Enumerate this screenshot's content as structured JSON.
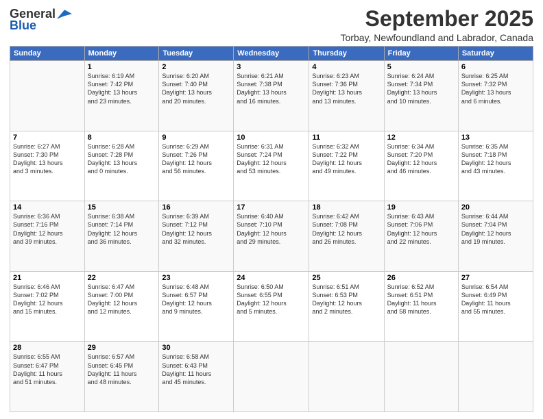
{
  "header": {
    "logo_general": "General",
    "logo_blue": "Blue",
    "month_title": "September 2025",
    "location": "Torbay, Newfoundland and Labrador, Canada"
  },
  "weekdays": [
    "Sunday",
    "Monday",
    "Tuesday",
    "Wednesday",
    "Thursday",
    "Friday",
    "Saturday"
  ],
  "weeks": [
    [
      {
        "day": "",
        "info": ""
      },
      {
        "day": "1",
        "info": "Sunrise: 6:19 AM\nSunset: 7:42 PM\nDaylight: 13 hours\nand 23 minutes."
      },
      {
        "day": "2",
        "info": "Sunrise: 6:20 AM\nSunset: 7:40 PM\nDaylight: 13 hours\nand 20 minutes."
      },
      {
        "day": "3",
        "info": "Sunrise: 6:21 AM\nSunset: 7:38 PM\nDaylight: 13 hours\nand 16 minutes."
      },
      {
        "day": "4",
        "info": "Sunrise: 6:23 AM\nSunset: 7:36 PM\nDaylight: 13 hours\nand 13 minutes."
      },
      {
        "day": "5",
        "info": "Sunrise: 6:24 AM\nSunset: 7:34 PM\nDaylight: 13 hours\nand 10 minutes."
      },
      {
        "day": "6",
        "info": "Sunrise: 6:25 AM\nSunset: 7:32 PM\nDaylight: 13 hours\nand 6 minutes."
      }
    ],
    [
      {
        "day": "7",
        "info": "Sunrise: 6:27 AM\nSunset: 7:30 PM\nDaylight: 13 hours\nand 3 minutes."
      },
      {
        "day": "8",
        "info": "Sunrise: 6:28 AM\nSunset: 7:28 PM\nDaylight: 13 hours\nand 0 minutes."
      },
      {
        "day": "9",
        "info": "Sunrise: 6:29 AM\nSunset: 7:26 PM\nDaylight: 12 hours\nand 56 minutes."
      },
      {
        "day": "10",
        "info": "Sunrise: 6:31 AM\nSunset: 7:24 PM\nDaylight: 12 hours\nand 53 minutes."
      },
      {
        "day": "11",
        "info": "Sunrise: 6:32 AM\nSunset: 7:22 PM\nDaylight: 12 hours\nand 49 minutes."
      },
      {
        "day": "12",
        "info": "Sunrise: 6:34 AM\nSunset: 7:20 PM\nDaylight: 12 hours\nand 46 minutes."
      },
      {
        "day": "13",
        "info": "Sunrise: 6:35 AM\nSunset: 7:18 PM\nDaylight: 12 hours\nand 43 minutes."
      }
    ],
    [
      {
        "day": "14",
        "info": "Sunrise: 6:36 AM\nSunset: 7:16 PM\nDaylight: 12 hours\nand 39 minutes."
      },
      {
        "day": "15",
        "info": "Sunrise: 6:38 AM\nSunset: 7:14 PM\nDaylight: 12 hours\nand 36 minutes."
      },
      {
        "day": "16",
        "info": "Sunrise: 6:39 AM\nSunset: 7:12 PM\nDaylight: 12 hours\nand 32 minutes."
      },
      {
        "day": "17",
        "info": "Sunrise: 6:40 AM\nSunset: 7:10 PM\nDaylight: 12 hours\nand 29 minutes."
      },
      {
        "day": "18",
        "info": "Sunrise: 6:42 AM\nSunset: 7:08 PM\nDaylight: 12 hours\nand 26 minutes."
      },
      {
        "day": "19",
        "info": "Sunrise: 6:43 AM\nSunset: 7:06 PM\nDaylight: 12 hours\nand 22 minutes."
      },
      {
        "day": "20",
        "info": "Sunrise: 6:44 AM\nSunset: 7:04 PM\nDaylight: 12 hours\nand 19 minutes."
      }
    ],
    [
      {
        "day": "21",
        "info": "Sunrise: 6:46 AM\nSunset: 7:02 PM\nDaylight: 12 hours\nand 15 minutes."
      },
      {
        "day": "22",
        "info": "Sunrise: 6:47 AM\nSunset: 7:00 PM\nDaylight: 12 hours\nand 12 minutes."
      },
      {
        "day": "23",
        "info": "Sunrise: 6:48 AM\nSunset: 6:57 PM\nDaylight: 12 hours\nand 9 minutes."
      },
      {
        "day": "24",
        "info": "Sunrise: 6:50 AM\nSunset: 6:55 PM\nDaylight: 12 hours\nand 5 minutes."
      },
      {
        "day": "25",
        "info": "Sunrise: 6:51 AM\nSunset: 6:53 PM\nDaylight: 12 hours\nand 2 minutes."
      },
      {
        "day": "26",
        "info": "Sunrise: 6:52 AM\nSunset: 6:51 PM\nDaylight: 11 hours\nand 58 minutes."
      },
      {
        "day": "27",
        "info": "Sunrise: 6:54 AM\nSunset: 6:49 PM\nDaylight: 11 hours\nand 55 minutes."
      }
    ],
    [
      {
        "day": "28",
        "info": "Sunrise: 6:55 AM\nSunset: 6:47 PM\nDaylight: 11 hours\nand 51 minutes."
      },
      {
        "day": "29",
        "info": "Sunrise: 6:57 AM\nSunset: 6:45 PM\nDaylight: 11 hours\nand 48 minutes."
      },
      {
        "day": "30",
        "info": "Sunrise: 6:58 AM\nSunset: 6:43 PM\nDaylight: 11 hours\nand 45 minutes."
      },
      {
        "day": "",
        "info": ""
      },
      {
        "day": "",
        "info": ""
      },
      {
        "day": "",
        "info": ""
      },
      {
        "day": "",
        "info": ""
      }
    ]
  ]
}
